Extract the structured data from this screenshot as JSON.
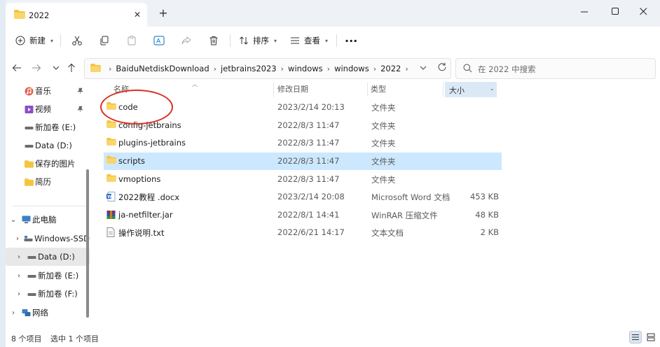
{
  "tab": {
    "title": "2022",
    "close_glyph": "✕",
    "newtab_glyph": "+"
  },
  "toolbar": {
    "new_label": "新建",
    "sort_label": "排序",
    "view_label": "查看",
    "more_glyph": "···"
  },
  "address": {
    "crumbs": [
      "BaiduNetdiskDownload",
      "jetbrains2023",
      "windows",
      "windows",
      "2022"
    ],
    "separator": "›",
    "search_placeholder": "在 2022 中搜索"
  },
  "nav": {
    "items": [
      {
        "label": "音乐",
        "icon": "music-icon",
        "pinned": true
      },
      {
        "label": "视频",
        "icon": "video-icon",
        "pinned": true
      },
      {
        "label": "新加卷 (E:)",
        "icon": "drive-icon",
        "pinned": false
      },
      {
        "label": "Data (D:)",
        "icon": "drive-icon",
        "pinned": false
      },
      {
        "label": "保存的图片",
        "icon": "folder-icon",
        "pinned": false
      },
      {
        "label": "简历",
        "icon": "folder-icon",
        "pinned": false
      }
    ],
    "tree": [
      {
        "label": "此电脑",
        "icon": "computer-icon",
        "expanded": true,
        "level": 0
      },
      {
        "label": "Windows-SSD",
        "icon": "drive-icon",
        "expanded": false,
        "level": 1
      },
      {
        "label": "Data (D:)",
        "icon": "drive-icon",
        "expanded": false,
        "level": 1,
        "selected": true
      },
      {
        "label": "新加卷 (E:)",
        "icon": "drive-icon",
        "expanded": false,
        "level": 1
      },
      {
        "label": "新加卷 (F:)",
        "icon": "drive-icon",
        "expanded": false,
        "level": 1
      },
      {
        "label": "网络",
        "icon": "network-icon",
        "expanded": false,
        "level": 0
      }
    ]
  },
  "columns": {
    "name": "名称",
    "date": "修改日期",
    "type": "类型",
    "size": "大小"
  },
  "files": [
    {
      "name": "code",
      "date": "2023/2/14 20:13",
      "type": "文件夹",
      "size": "",
      "icon": "folder-icon"
    },
    {
      "name": "config-jetbrains",
      "date": "2022/8/3 11:47",
      "type": "文件夹",
      "size": "",
      "icon": "folder-icon"
    },
    {
      "name": "plugins-jetbrains",
      "date": "2022/8/3 11:47",
      "type": "文件夹",
      "size": "",
      "icon": "folder-icon"
    },
    {
      "name": "scripts",
      "date": "2022/8/3 11:47",
      "type": "文件夹",
      "size": "",
      "icon": "folder-icon",
      "selected": true
    },
    {
      "name": "vmoptions",
      "date": "2022/8/3 11:47",
      "type": "文件夹",
      "size": "",
      "icon": "folder-icon"
    },
    {
      "name": "2022教程 .docx",
      "date": "2023/2/14 20:08",
      "type": "Microsoft Word 文档",
      "size": "453 KB",
      "icon": "word-doc-icon"
    },
    {
      "name": "ja-netfilter.jar",
      "date": "2022/8/1 14:41",
      "type": "WinRAR 压缩文件",
      "size": "48 KB",
      "icon": "winrar-icon"
    },
    {
      "name": "操作说明.txt",
      "date": "2022/6/21 14:17",
      "type": "文本文档",
      "size": "2 KB",
      "icon": "text-file-icon"
    }
  ],
  "status": {
    "item_count": "8 个项目",
    "selection": "选中 1 个项目"
  },
  "colors": {
    "selection": "#cce8ff",
    "folder": "#f4c542",
    "annotation": "#d93025",
    "accent": "#0067c0"
  }
}
